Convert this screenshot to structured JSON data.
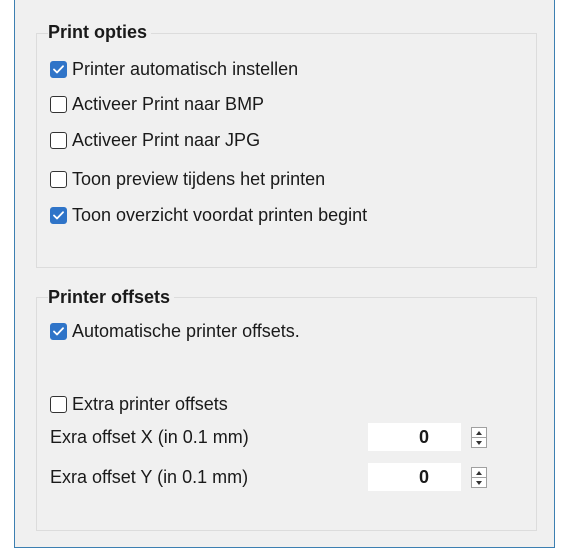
{
  "print_options": {
    "title": "Print opties",
    "items": [
      {
        "label": "Printer automatisch instellen",
        "checked": true
      },
      {
        "label": "Activeer Print naar BMP",
        "checked": false
      },
      {
        "label": "Activeer Print naar JPG",
        "checked": false
      },
      {
        "label": "Toon preview tijdens het printen",
        "checked": false
      },
      {
        "label": "Toon overzicht voordat printen begint",
        "checked": true
      }
    ]
  },
  "printer_offsets": {
    "title": "Printer offsets",
    "auto_offsets": {
      "label": "Automatische printer offsets.",
      "checked": true
    },
    "extra_offsets": {
      "label": "Extra printer offsets",
      "checked": false
    },
    "offset_x": {
      "label": "Exra offset X (in 0.1 mm)",
      "value": "0"
    },
    "offset_y": {
      "label": "Exra offset Y (in 0.1 mm)",
      "value": "0"
    }
  },
  "colors": {
    "checkbox_checked": "#2f74c8",
    "panel_background": "#f0f0f0",
    "panel_border": "#3c7fb1"
  }
}
